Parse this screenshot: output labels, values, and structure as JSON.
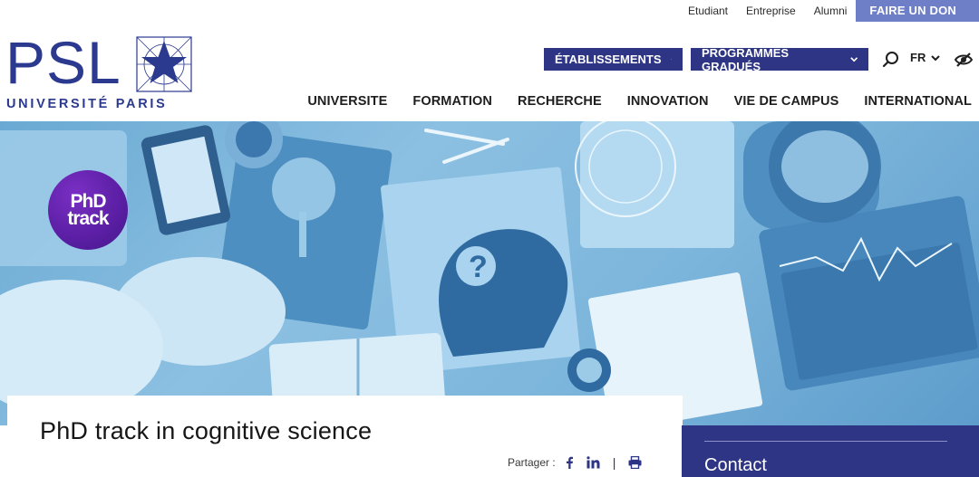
{
  "topbar": {
    "links": [
      "Etudiant",
      "Entreprise",
      "Alumni"
    ],
    "donate_label": "FAIRE UN DON"
  },
  "logo": {
    "main": "PSL",
    "sub": "UNIVERSITÉ PARIS"
  },
  "header": {
    "btn_etablissements": "ÉTABLISSEMENTS",
    "btn_programmes": "PROGRAMMES GRADUÉS",
    "lang": "FR"
  },
  "nav": {
    "items": [
      "UNIVERSITE",
      "FORMATION",
      "RECHERCHE",
      "INNOVATION",
      "VIE DE CAMPUS",
      "INTERNATIONAL"
    ]
  },
  "hero": {
    "badge_line1": "PhD",
    "badge_line2": "track"
  },
  "content": {
    "title": "PhD track in cognitive science",
    "share_label": "Partager :",
    "share_sep": "|"
  },
  "sidebar": {
    "contact_label": "Contact"
  },
  "colors": {
    "brand_blue": "#2e3584",
    "logo_blue": "#2b3a8f",
    "donate": "#6f7fc7",
    "badge_purple": "#5a1ea3",
    "hero_blue": "#7cb5db"
  },
  "icons": [
    "star-logo-icon",
    "chevron-down-icon",
    "search-icon",
    "eye-slash-icon",
    "facebook-icon",
    "linkedin-icon",
    "print-icon"
  ]
}
